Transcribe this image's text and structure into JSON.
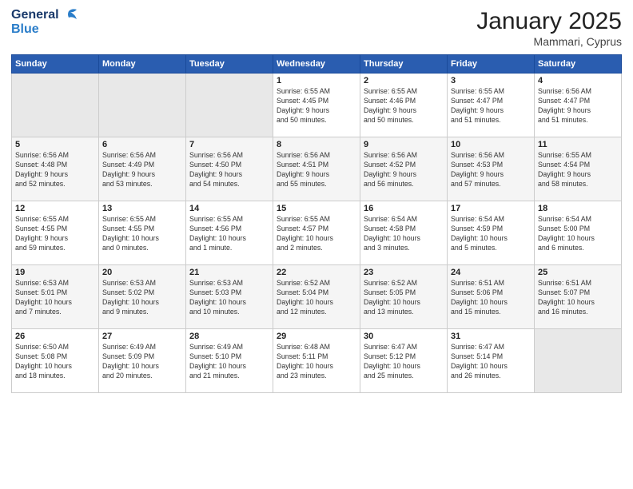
{
  "header": {
    "title": "January 2025",
    "subtitle": "Mammari, Cyprus"
  },
  "columns": [
    "Sunday",
    "Monday",
    "Tuesday",
    "Wednesday",
    "Thursday",
    "Friday",
    "Saturday"
  ],
  "weeks": [
    [
      {
        "day": "",
        "info": ""
      },
      {
        "day": "",
        "info": ""
      },
      {
        "day": "",
        "info": ""
      },
      {
        "day": "1",
        "info": "Sunrise: 6:55 AM\nSunset: 4:45 PM\nDaylight: 9 hours\nand 50 minutes."
      },
      {
        "day": "2",
        "info": "Sunrise: 6:55 AM\nSunset: 4:46 PM\nDaylight: 9 hours\nand 50 minutes."
      },
      {
        "day": "3",
        "info": "Sunrise: 6:55 AM\nSunset: 4:47 PM\nDaylight: 9 hours\nand 51 minutes."
      },
      {
        "day": "4",
        "info": "Sunrise: 6:56 AM\nSunset: 4:47 PM\nDaylight: 9 hours\nand 51 minutes."
      }
    ],
    [
      {
        "day": "5",
        "info": "Sunrise: 6:56 AM\nSunset: 4:48 PM\nDaylight: 9 hours\nand 52 minutes."
      },
      {
        "day": "6",
        "info": "Sunrise: 6:56 AM\nSunset: 4:49 PM\nDaylight: 9 hours\nand 53 minutes."
      },
      {
        "day": "7",
        "info": "Sunrise: 6:56 AM\nSunset: 4:50 PM\nDaylight: 9 hours\nand 54 minutes."
      },
      {
        "day": "8",
        "info": "Sunrise: 6:56 AM\nSunset: 4:51 PM\nDaylight: 9 hours\nand 55 minutes."
      },
      {
        "day": "9",
        "info": "Sunrise: 6:56 AM\nSunset: 4:52 PM\nDaylight: 9 hours\nand 56 minutes."
      },
      {
        "day": "10",
        "info": "Sunrise: 6:56 AM\nSunset: 4:53 PM\nDaylight: 9 hours\nand 57 minutes."
      },
      {
        "day": "11",
        "info": "Sunrise: 6:55 AM\nSunset: 4:54 PM\nDaylight: 9 hours\nand 58 minutes."
      }
    ],
    [
      {
        "day": "12",
        "info": "Sunrise: 6:55 AM\nSunset: 4:55 PM\nDaylight: 9 hours\nand 59 minutes."
      },
      {
        "day": "13",
        "info": "Sunrise: 6:55 AM\nSunset: 4:55 PM\nDaylight: 10 hours\nand 0 minutes."
      },
      {
        "day": "14",
        "info": "Sunrise: 6:55 AM\nSunset: 4:56 PM\nDaylight: 10 hours\nand 1 minute."
      },
      {
        "day": "15",
        "info": "Sunrise: 6:55 AM\nSunset: 4:57 PM\nDaylight: 10 hours\nand 2 minutes."
      },
      {
        "day": "16",
        "info": "Sunrise: 6:54 AM\nSunset: 4:58 PM\nDaylight: 10 hours\nand 3 minutes."
      },
      {
        "day": "17",
        "info": "Sunrise: 6:54 AM\nSunset: 4:59 PM\nDaylight: 10 hours\nand 5 minutes."
      },
      {
        "day": "18",
        "info": "Sunrise: 6:54 AM\nSunset: 5:00 PM\nDaylight: 10 hours\nand 6 minutes."
      }
    ],
    [
      {
        "day": "19",
        "info": "Sunrise: 6:53 AM\nSunset: 5:01 PM\nDaylight: 10 hours\nand 7 minutes."
      },
      {
        "day": "20",
        "info": "Sunrise: 6:53 AM\nSunset: 5:02 PM\nDaylight: 10 hours\nand 9 minutes."
      },
      {
        "day": "21",
        "info": "Sunrise: 6:53 AM\nSunset: 5:03 PM\nDaylight: 10 hours\nand 10 minutes."
      },
      {
        "day": "22",
        "info": "Sunrise: 6:52 AM\nSunset: 5:04 PM\nDaylight: 10 hours\nand 12 minutes."
      },
      {
        "day": "23",
        "info": "Sunrise: 6:52 AM\nSunset: 5:05 PM\nDaylight: 10 hours\nand 13 minutes."
      },
      {
        "day": "24",
        "info": "Sunrise: 6:51 AM\nSunset: 5:06 PM\nDaylight: 10 hours\nand 15 minutes."
      },
      {
        "day": "25",
        "info": "Sunrise: 6:51 AM\nSunset: 5:07 PM\nDaylight: 10 hours\nand 16 minutes."
      }
    ],
    [
      {
        "day": "26",
        "info": "Sunrise: 6:50 AM\nSunset: 5:08 PM\nDaylight: 10 hours\nand 18 minutes."
      },
      {
        "day": "27",
        "info": "Sunrise: 6:49 AM\nSunset: 5:09 PM\nDaylight: 10 hours\nand 20 minutes."
      },
      {
        "day": "28",
        "info": "Sunrise: 6:49 AM\nSunset: 5:10 PM\nDaylight: 10 hours\nand 21 minutes."
      },
      {
        "day": "29",
        "info": "Sunrise: 6:48 AM\nSunset: 5:11 PM\nDaylight: 10 hours\nand 23 minutes."
      },
      {
        "day": "30",
        "info": "Sunrise: 6:47 AM\nSunset: 5:12 PM\nDaylight: 10 hours\nand 25 minutes."
      },
      {
        "day": "31",
        "info": "Sunrise: 6:47 AM\nSunset: 5:14 PM\nDaylight: 10 hours\nand 26 minutes."
      },
      {
        "day": "",
        "info": ""
      }
    ]
  ]
}
